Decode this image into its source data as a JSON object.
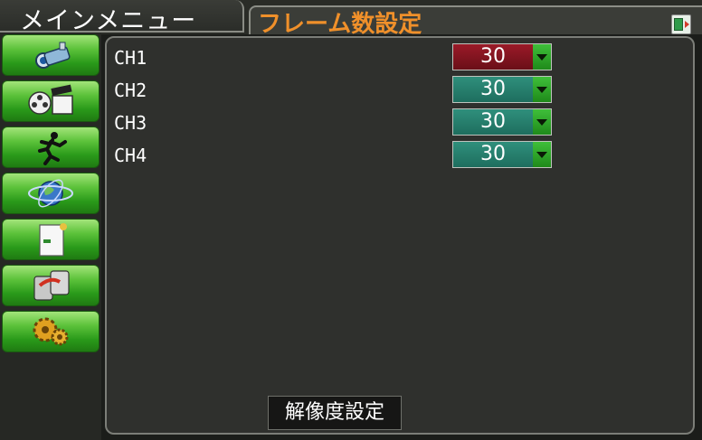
{
  "header": {
    "main_menu_tab": "メインメニュー",
    "submenu_title": "フレーム数設定",
    "exit_icon": "exit-door-icon"
  },
  "sidebar": {
    "items": [
      {
        "icon": "camera-icon"
      },
      {
        "icon": "film-playback-icon"
      },
      {
        "icon": "runner-icon"
      },
      {
        "icon": "network-globe-icon"
      },
      {
        "icon": "document-icon"
      },
      {
        "icon": "hdd-icon"
      },
      {
        "icon": "gears-icon"
      }
    ]
  },
  "channels": [
    {
      "label": "CH1",
      "value": "30"
    },
    {
      "label": "CH2",
      "value": "30"
    },
    {
      "label": "CH3",
      "value": "30"
    },
    {
      "label": "CH4",
      "value": "30"
    }
  ],
  "bottom_button": "解像度設定",
  "colors": {
    "accent_orange": "#f0902a",
    "selected_red": "#9b1a28",
    "dropdown_teal": "#2f8f7c",
    "sidebar_green": "#2a9a1a"
  }
}
